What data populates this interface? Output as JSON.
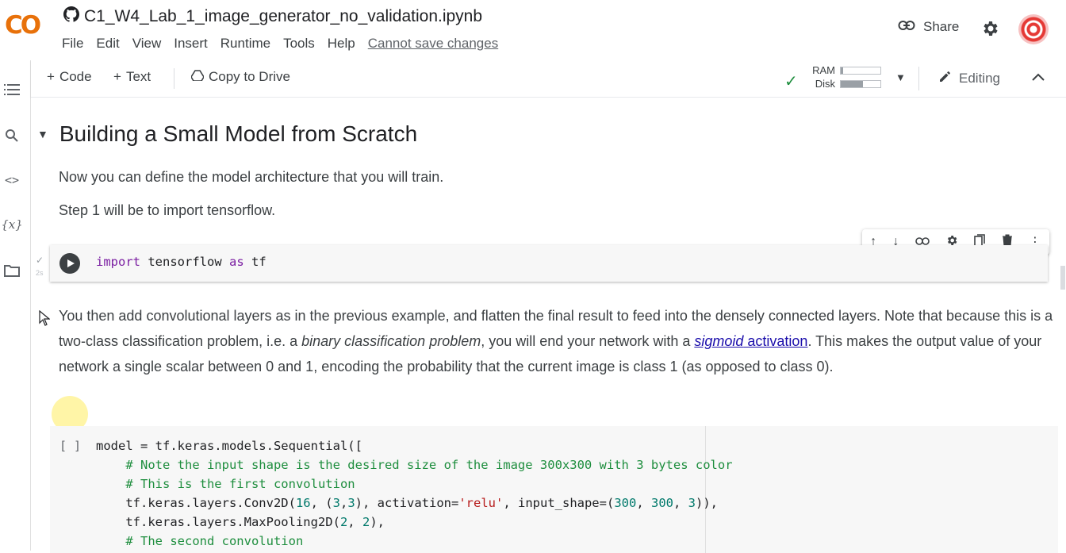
{
  "header": {
    "logo": "CO",
    "notebook_title": "C1_W4_Lab_1_image_generator_no_validation.ipynb",
    "menu": [
      "File",
      "Edit",
      "View",
      "Insert",
      "Runtime",
      "Tools",
      "Help"
    ],
    "save_status": "Cannot save changes",
    "share_label": "Share"
  },
  "toolbar": {
    "add_code": "Code",
    "add_text": "Text",
    "copy_to_drive": "Copy to Drive",
    "ram_label": "RAM",
    "disk_label": "Disk",
    "ram_usage_fraction": 0.05,
    "disk_usage_fraction": 0.55,
    "editing_label": "Editing"
  },
  "content": {
    "section_title": "Building a Small Model from Scratch",
    "para1": "Now you can define the model architecture that you will train.",
    "para2": "Step 1 will be to import tensorflow.",
    "cell1": {
      "exec_time": "2s",
      "kw_import": "import",
      "module": " tensorflow ",
      "kw_as": "as",
      "alias": " tf"
    },
    "para3": {
      "part1": "You then add convolutional layers as in the previous example, and flatten the final result to feed into the densely connected layers. Note that because this is a two-class classification problem, i.e. a ",
      "em": "binary classification problem",
      "part2": ", you will end your network with a ",
      "link_em": "sigmoid",
      "link_rest": " activation",
      "part3": ". This makes the output value of your network a single scalar between 0 and 1, encoding the probability that the current image is class 1 (as opposed to class 0)."
    },
    "cell2": {
      "bracket": "[ ]",
      "line1": "model = tf.keras.models.Sequential([",
      "line2": "    # Note the input shape is the desired size of the image 300x300 with 3 bytes color",
      "line3": "    # This is the first convolution",
      "line4_a": "    tf.keras.layers.Conv2D(",
      "line4_n1": "16",
      "line4_b": ", (",
      "line4_n2": "3",
      "line4_c": ",",
      "line4_n3": "3",
      "line4_d": "), activation=",
      "line4_s": "'relu'",
      "line4_e": ", input_shape=(",
      "line4_n4": "300",
      "line4_f": ", ",
      "line4_n5": "300",
      "line4_g": ", ",
      "line4_n6": "3",
      "line4_h": ")),",
      "line5_a": "    tf.keras.layers.MaxPooling2D(",
      "line5_n1": "2",
      "line5_b": ", ",
      "line5_n2": "2",
      "line5_c": "),",
      "line6": "    # The second convolution"
    }
  },
  "colors": {
    "logo_orange": "#f9ab00",
    "logo_dark_orange": "#e8710a",
    "link": "#1a0dab",
    "comment_green": "#1e8e3e",
    "keyword_purple": "#7b1fa2",
    "string_red": "#b71c1c",
    "number_teal": "#00796b"
  }
}
